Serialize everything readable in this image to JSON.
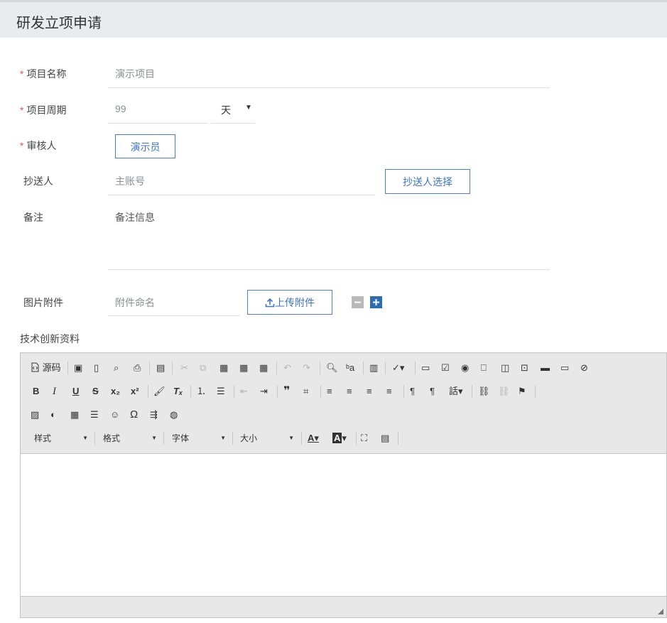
{
  "page": {
    "title": "研发立项申请"
  },
  "form": {
    "project_name": {
      "label": "项目名称",
      "required_mark": "*",
      "value": "演示项目"
    },
    "project_period": {
      "label": "项目周期",
      "required_mark": "*",
      "value": "99",
      "unit": "天"
    },
    "reviewer": {
      "label": "审核人",
      "required_mark": "*",
      "value": "演示员"
    },
    "cc": {
      "label": "抄送人",
      "placeholder": "主账号",
      "button": "抄送人选择"
    },
    "remark": {
      "label": "备注",
      "placeholder": "备注信息"
    },
    "attachment": {
      "label": "图片附件",
      "placeholder": "附件命名",
      "upload_button": "上传附件"
    },
    "tech_material": {
      "label": "技术创新资料"
    }
  },
  "editor": {
    "source_label": "源码",
    "combos": {
      "style": "样式",
      "format": "格式",
      "font": "字体",
      "size": "大小"
    },
    "icons": {
      "bold": "B",
      "italic": "I",
      "underline": "U",
      "strike": "S",
      "subscript": "x₂",
      "superscript": "x²",
      "blockquote": "❞",
      "omega": "Ω"
    }
  }
}
